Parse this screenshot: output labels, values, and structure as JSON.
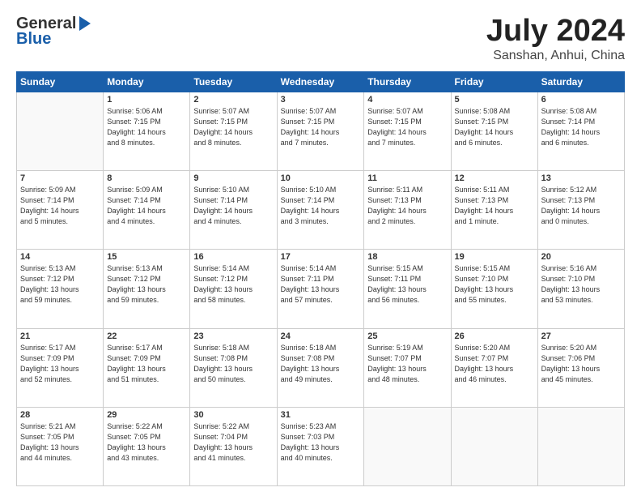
{
  "header": {
    "logo_general": "General",
    "logo_blue": "Blue",
    "month_year": "July 2024",
    "location": "Sanshan, Anhui, China"
  },
  "weekdays": [
    "Sunday",
    "Monday",
    "Tuesday",
    "Wednesday",
    "Thursday",
    "Friday",
    "Saturday"
  ],
  "weeks": [
    [
      {
        "day": "",
        "sunrise": "",
        "sunset": "",
        "daylight": ""
      },
      {
        "day": "1",
        "sunrise": "Sunrise: 5:06 AM",
        "sunset": "Sunset: 7:15 PM",
        "daylight": "Daylight: 14 hours and 8 minutes."
      },
      {
        "day": "2",
        "sunrise": "Sunrise: 5:07 AM",
        "sunset": "Sunset: 7:15 PM",
        "daylight": "Daylight: 14 hours and 8 minutes."
      },
      {
        "day": "3",
        "sunrise": "Sunrise: 5:07 AM",
        "sunset": "Sunset: 7:15 PM",
        "daylight": "Daylight: 14 hours and 7 minutes."
      },
      {
        "day": "4",
        "sunrise": "Sunrise: 5:07 AM",
        "sunset": "Sunset: 7:15 PM",
        "daylight": "Daylight: 14 hours and 7 minutes."
      },
      {
        "day": "5",
        "sunrise": "Sunrise: 5:08 AM",
        "sunset": "Sunset: 7:15 PM",
        "daylight": "Daylight: 14 hours and 6 minutes."
      },
      {
        "day": "6",
        "sunrise": "Sunrise: 5:08 AM",
        "sunset": "Sunset: 7:14 PM",
        "daylight": "Daylight: 14 hours and 6 minutes."
      }
    ],
    [
      {
        "day": "7",
        "sunrise": "Sunrise: 5:09 AM",
        "sunset": "Sunset: 7:14 PM",
        "daylight": "Daylight: 14 hours and 5 minutes."
      },
      {
        "day": "8",
        "sunrise": "Sunrise: 5:09 AM",
        "sunset": "Sunset: 7:14 PM",
        "daylight": "Daylight: 14 hours and 4 minutes."
      },
      {
        "day": "9",
        "sunrise": "Sunrise: 5:10 AM",
        "sunset": "Sunset: 7:14 PM",
        "daylight": "Daylight: 14 hours and 4 minutes."
      },
      {
        "day": "10",
        "sunrise": "Sunrise: 5:10 AM",
        "sunset": "Sunset: 7:14 PM",
        "daylight": "Daylight: 14 hours and 3 minutes."
      },
      {
        "day": "11",
        "sunrise": "Sunrise: 5:11 AM",
        "sunset": "Sunset: 7:13 PM",
        "daylight": "Daylight: 14 hours and 2 minutes."
      },
      {
        "day": "12",
        "sunrise": "Sunrise: 5:11 AM",
        "sunset": "Sunset: 7:13 PM",
        "daylight": "Daylight: 14 hours and 1 minute."
      },
      {
        "day": "13",
        "sunrise": "Sunrise: 5:12 AM",
        "sunset": "Sunset: 7:13 PM",
        "daylight": "Daylight: 14 hours and 0 minutes."
      }
    ],
    [
      {
        "day": "14",
        "sunrise": "Sunrise: 5:13 AM",
        "sunset": "Sunset: 7:12 PM",
        "daylight": "Daylight: 13 hours and 59 minutes."
      },
      {
        "day": "15",
        "sunrise": "Sunrise: 5:13 AM",
        "sunset": "Sunset: 7:12 PM",
        "daylight": "Daylight: 13 hours and 59 minutes."
      },
      {
        "day": "16",
        "sunrise": "Sunrise: 5:14 AM",
        "sunset": "Sunset: 7:12 PM",
        "daylight": "Daylight: 13 hours and 58 minutes."
      },
      {
        "day": "17",
        "sunrise": "Sunrise: 5:14 AM",
        "sunset": "Sunset: 7:11 PM",
        "daylight": "Daylight: 13 hours and 57 minutes."
      },
      {
        "day": "18",
        "sunrise": "Sunrise: 5:15 AM",
        "sunset": "Sunset: 7:11 PM",
        "daylight": "Daylight: 13 hours and 56 minutes."
      },
      {
        "day": "19",
        "sunrise": "Sunrise: 5:15 AM",
        "sunset": "Sunset: 7:10 PM",
        "daylight": "Daylight: 13 hours and 55 minutes."
      },
      {
        "day": "20",
        "sunrise": "Sunrise: 5:16 AM",
        "sunset": "Sunset: 7:10 PM",
        "daylight": "Daylight: 13 hours and 53 minutes."
      }
    ],
    [
      {
        "day": "21",
        "sunrise": "Sunrise: 5:17 AM",
        "sunset": "Sunset: 7:09 PM",
        "daylight": "Daylight: 13 hours and 52 minutes."
      },
      {
        "day": "22",
        "sunrise": "Sunrise: 5:17 AM",
        "sunset": "Sunset: 7:09 PM",
        "daylight": "Daylight: 13 hours and 51 minutes."
      },
      {
        "day": "23",
        "sunrise": "Sunrise: 5:18 AM",
        "sunset": "Sunset: 7:08 PM",
        "daylight": "Daylight: 13 hours and 50 minutes."
      },
      {
        "day": "24",
        "sunrise": "Sunrise: 5:18 AM",
        "sunset": "Sunset: 7:08 PM",
        "daylight": "Daylight: 13 hours and 49 minutes."
      },
      {
        "day": "25",
        "sunrise": "Sunrise: 5:19 AM",
        "sunset": "Sunset: 7:07 PM",
        "daylight": "Daylight: 13 hours and 48 minutes."
      },
      {
        "day": "26",
        "sunrise": "Sunrise: 5:20 AM",
        "sunset": "Sunset: 7:07 PM",
        "daylight": "Daylight: 13 hours and 46 minutes."
      },
      {
        "day": "27",
        "sunrise": "Sunrise: 5:20 AM",
        "sunset": "Sunset: 7:06 PM",
        "daylight": "Daylight: 13 hours and 45 minutes."
      }
    ],
    [
      {
        "day": "28",
        "sunrise": "Sunrise: 5:21 AM",
        "sunset": "Sunset: 7:05 PM",
        "daylight": "Daylight: 13 hours and 44 minutes."
      },
      {
        "day": "29",
        "sunrise": "Sunrise: 5:22 AM",
        "sunset": "Sunset: 7:05 PM",
        "daylight": "Daylight: 13 hours and 43 minutes."
      },
      {
        "day": "30",
        "sunrise": "Sunrise: 5:22 AM",
        "sunset": "Sunset: 7:04 PM",
        "daylight": "Daylight: 13 hours and 41 minutes."
      },
      {
        "day": "31",
        "sunrise": "Sunrise: 5:23 AM",
        "sunset": "Sunset: 7:03 PM",
        "daylight": "Daylight: 13 hours and 40 minutes."
      },
      {
        "day": "",
        "sunrise": "",
        "sunset": "",
        "daylight": ""
      },
      {
        "day": "",
        "sunrise": "",
        "sunset": "",
        "daylight": ""
      },
      {
        "day": "",
        "sunrise": "",
        "sunset": "",
        "daylight": ""
      }
    ]
  ]
}
